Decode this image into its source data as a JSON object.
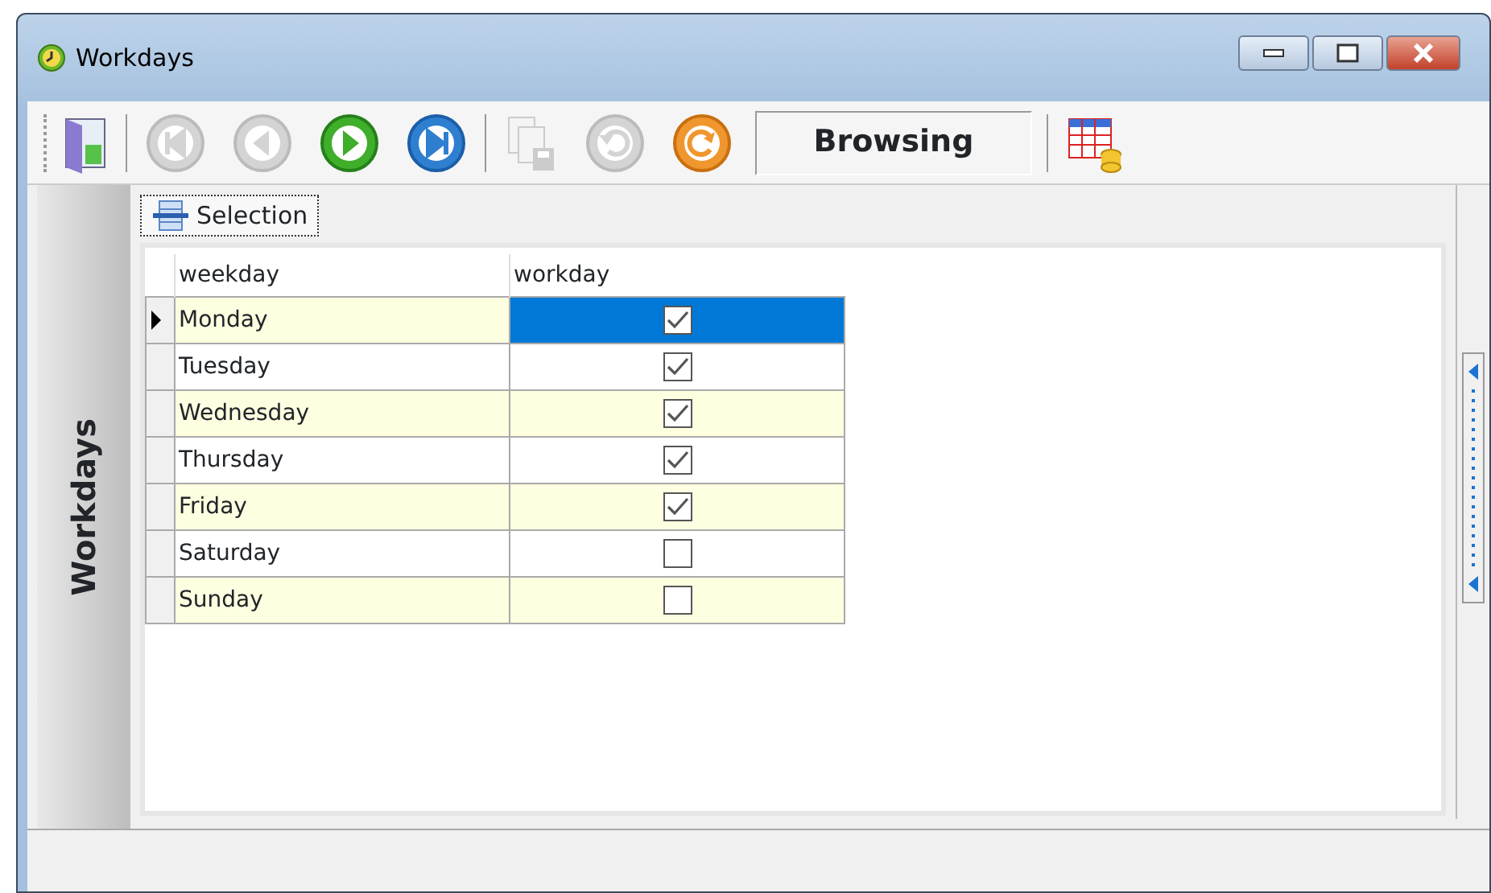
{
  "window": {
    "title": "Workdays"
  },
  "toolbar": [
    {
      "kind": "exit",
      "disabled": false
    },
    {
      "kind": "first",
      "disabled": true
    },
    {
      "kind": "prior",
      "disabled": true
    },
    {
      "kind": "next",
      "disabled": false
    },
    {
      "kind": "last",
      "disabled": false
    },
    {
      "kind": "copy",
      "disabled": true
    },
    {
      "kind": "undo",
      "disabled": true
    },
    {
      "kind": "refresh",
      "disabled": false
    },
    {
      "kind": "status",
      "text": "Browsing"
    },
    {
      "kind": "grid",
      "disabled": false
    }
  ],
  "side_panel": {
    "title": "Workdays"
  },
  "tabs": [
    {
      "label": "Selection",
      "selected": true
    }
  ],
  "table": {
    "columns": [
      "weekday",
      "workday"
    ],
    "rows": [
      {
        "weekday": "Monday",
        "workday": true,
        "current": true,
        "selected": true
      },
      {
        "weekday": "Tuesday",
        "workday": true,
        "current": false,
        "selected": false
      },
      {
        "weekday": "Wednesday",
        "workday": true,
        "current": false,
        "selected": false
      },
      {
        "weekday": "Thursday",
        "workday": true,
        "current": false,
        "selected": false
      },
      {
        "weekday": "Friday",
        "workday": true,
        "current": false,
        "selected": false
      },
      {
        "weekday": "Saturday",
        "workday": false,
        "current": false,
        "selected": false
      },
      {
        "weekday": "Sunday",
        "workday": false,
        "current": false,
        "selected": false
      }
    ]
  }
}
